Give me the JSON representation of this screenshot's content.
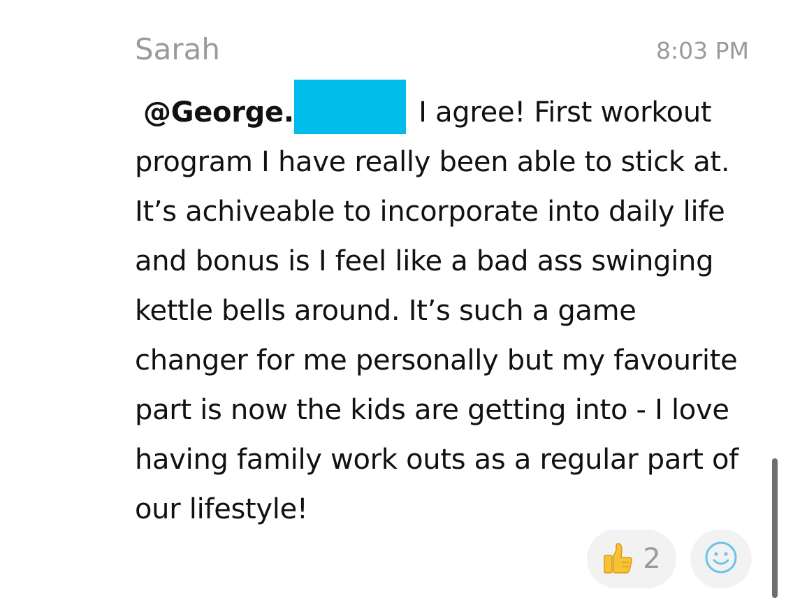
{
  "message": {
    "sender": "Sarah",
    "time": "8:03 PM",
    "mention": "@George.",
    "text": "I agree! First workout program I have really been able to stick at. It’s achiveable to incorporate into daily life and bonus is I feel like a bad ass swinging kettle bells around. It’s such a game changer for me personally but my favourite part is now the kids are getting into - I love having family work outs as a regular part of our lifestyle!"
  },
  "reactions": {
    "thumbs_up": {
      "icon": "thumbs-up-icon",
      "count": "2"
    },
    "add_reaction": {
      "icon": "smiley-face-icon"
    }
  },
  "colors": {
    "redaction": "#00bceb",
    "muted_text": "#9a9a9a",
    "pill_background": "#f2f2f2",
    "emoji_yellow": "#f7c236",
    "smiley_stroke": "#6cc2ea"
  }
}
